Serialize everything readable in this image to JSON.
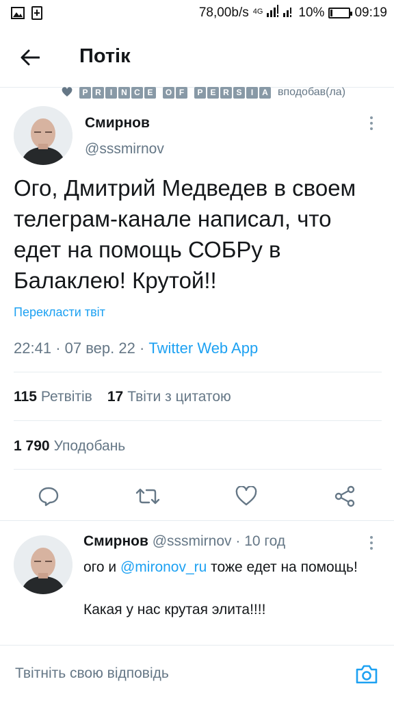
{
  "status_bar": {
    "speed": "78,00b/s",
    "network": "4G",
    "battery_percent": "10%",
    "battery_level": 0.1,
    "time": "09:19"
  },
  "header": {
    "title": "Потік",
    "back_icon": "arrow-left-icon"
  },
  "social_context": {
    "user_name": "PRINCE OF PERSIA",
    "action": "вподобав(ла)"
  },
  "tweet": {
    "author_name": "Смирнов",
    "author_handle": "@sssmirnov",
    "text": "Ого, Дмитрий Медведев в своем телеграм-канале написал, что едет на помощь СОБРу в Балаклею! Крутой!!",
    "translate_label": "Перекласти твіт",
    "time": "22:41",
    "date": "07 вер. 22",
    "separator": "·",
    "source": "Twitter Web App",
    "retweets_count": "115",
    "retweets_label": "Ретвітів",
    "quotes_count": "17",
    "quotes_label": "Твіти з цитатою",
    "likes_count": "1 790",
    "likes_label": "Уподобань"
  },
  "actions": [
    "reply-icon",
    "retweet-icon",
    "like-icon",
    "share-icon"
  ],
  "reply": {
    "author_name": "Смирнов",
    "author_handle": "@sssmirnov",
    "separator": "·",
    "age": "10 год",
    "text_start": "ого и ",
    "mention": "@mironov_ru",
    "text_end": " тоже едет на помощь!",
    "text_line2": "Какая у нас крутая элита!!!!"
  },
  "composer": {
    "placeholder": "Твітніть свою відповідь",
    "camera_icon": "camera-icon"
  },
  "colors": {
    "accent": "#1da1f2",
    "secondary_text": "#657786",
    "primary_text": "#14171a",
    "divider": "#e6ecf0"
  }
}
